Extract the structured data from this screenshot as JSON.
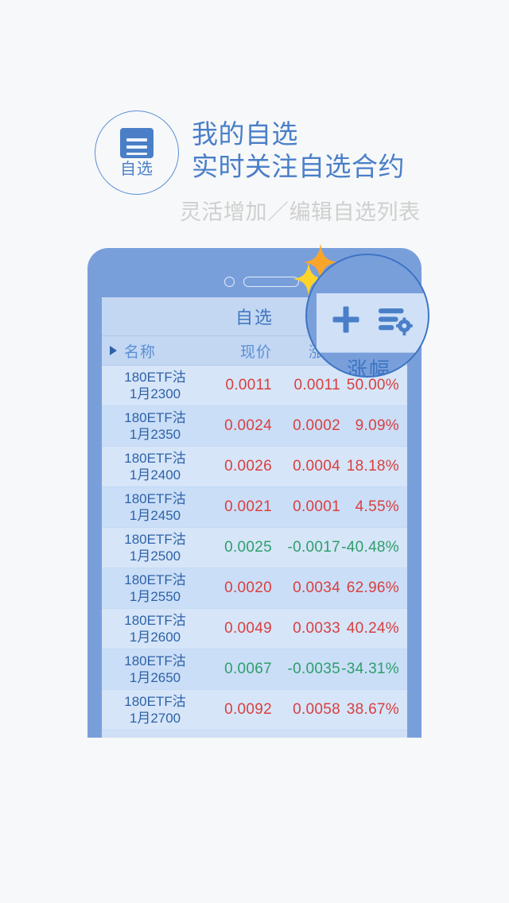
{
  "promo": {
    "badge": {
      "label": "自选",
      "icon": "list-card-icon"
    },
    "title_line1": "我的自选",
    "title_line2": "实时关注自选合约",
    "subtitle": "灵活增加／编辑自选列表",
    "title_color": "#4a7fc8",
    "subtitle_color": "#cfcfcf"
  },
  "phone": {
    "bezel_color": "#799fdb",
    "screen_bg": "#cfe0f7"
  },
  "app": {
    "titlebar": {
      "title": "自选",
      "actions": [
        {
          "name": "add-watchlist-button",
          "icon": "plus-icon"
        },
        {
          "name": "edit-watchlist-button",
          "icon": "list-settings-icon"
        }
      ]
    },
    "table": {
      "sort_indicator": "sort-arrow-icon",
      "columns": [
        "名称",
        "现价",
        "涨跌",
        "涨幅"
      ],
      "rows": [
        {
          "name_line1": "180ETF沽",
          "name_line2": "1月2300",
          "price": "0.0011",
          "change": "0.0011",
          "percent": "50.00%",
          "direction": "up"
        },
        {
          "name_line1": "180ETF沽",
          "name_line2": "1月2350",
          "price": "0.0024",
          "change": "0.0002",
          "percent": "9.09%",
          "direction": "up"
        },
        {
          "name_line1": "180ETF沽",
          "name_line2": "1月2400",
          "price": "0.0026",
          "change": "0.0004",
          "percent": "18.18%",
          "direction": "up"
        },
        {
          "name_line1": "180ETF沽",
          "name_line2": "1月2450",
          "price": "0.0021",
          "change": "0.0001",
          "percent": "4.55%",
          "direction": "up"
        },
        {
          "name_line1": "180ETF沽",
          "name_line2": "1月2500",
          "price": "0.0025",
          "change": "-0.0017",
          "percent": "-40.48%",
          "direction": "down"
        },
        {
          "name_line1": "180ETF沽",
          "name_line2": "1月2550",
          "price": "0.0020",
          "change": "0.0034",
          "percent": "62.96%",
          "direction": "up"
        },
        {
          "name_line1": "180ETF沽",
          "name_line2": "1月2600",
          "price": "0.0049",
          "change": "0.0033",
          "percent": "40.24%",
          "direction": "up"
        },
        {
          "name_line1": "180ETF沽",
          "name_line2": "1月2650",
          "price": "0.0067",
          "change": "-0.0035",
          "percent": "-34.31%",
          "direction": "down"
        },
        {
          "name_line1": "180ETF沽",
          "name_line2": "1月2700",
          "price": "0.0092",
          "change": "0.0058",
          "percent": "38.67%",
          "direction": "up"
        }
      ],
      "up_color": "#d93f3f",
      "down_color": "#2e9e6b"
    }
  },
  "magnifier": {
    "label": "涨幅",
    "icons": [
      "plus-icon",
      "list-settings-icon"
    ],
    "border_color": "#3d74c4"
  },
  "sparkles": [
    {
      "name": "sparkle-small",
      "color": "#ffd429"
    },
    {
      "name": "sparkle-large",
      "color": "#f9a councillor"
    }
  ]
}
